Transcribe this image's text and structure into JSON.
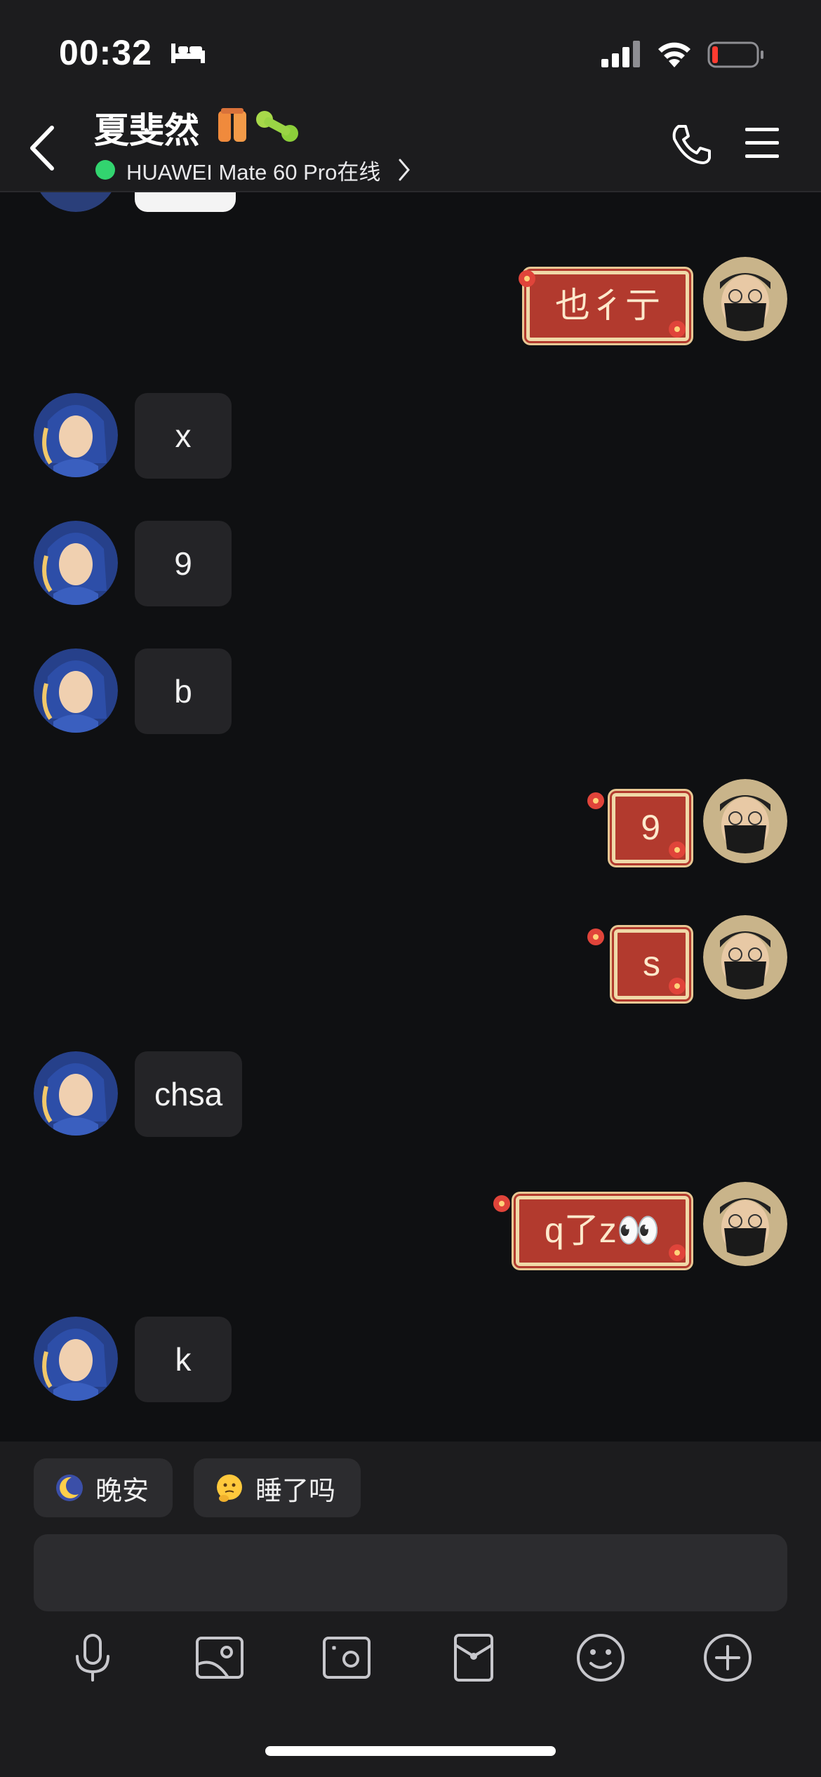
{
  "status_bar": {
    "time": "00:32",
    "icons": [
      "bed-icon",
      "cellular-signal-icon",
      "wifi-icon",
      "battery-low-icon"
    ]
  },
  "header": {
    "title": "夏斐然",
    "status_text": "HUAWEI Mate 60 Pro在线",
    "status_color": "#32d46f"
  },
  "messages": [
    {
      "side": "out",
      "text": "也彳亍"
    },
    {
      "side": "in",
      "text": "x"
    },
    {
      "side": "in",
      "text": "9"
    },
    {
      "side": "in",
      "text": "b"
    },
    {
      "side": "out",
      "text": "9"
    },
    {
      "side": "out",
      "text": "s"
    },
    {
      "side": "in",
      "text": "chsa"
    },
    {
      "side": "out",
      "text": "q了z👀"
    },
    {
      "side": "in",
      "text": "k"
    }
  ],
  "quick_replies": [
    {
      "emoji": "moon-face-icon",
      "label": "晚安"
    },
    {
      "emoji": "thinking-face-icon",
      "label": "睡了吗"
    }
  ],
  "input": {
    "value": ""
  },
  "toolbar": [
    "microphone-icon",
    "image-icon",
    "camera-icon",
    "red-packet-icon",
    "emoji-icon",
    "plus-icon"
  ],
  "colors": {
    "bubble_in": "#242427",
    "bubble_out": "#b23a2e",
    "background": "#0f1012"
  }
}
